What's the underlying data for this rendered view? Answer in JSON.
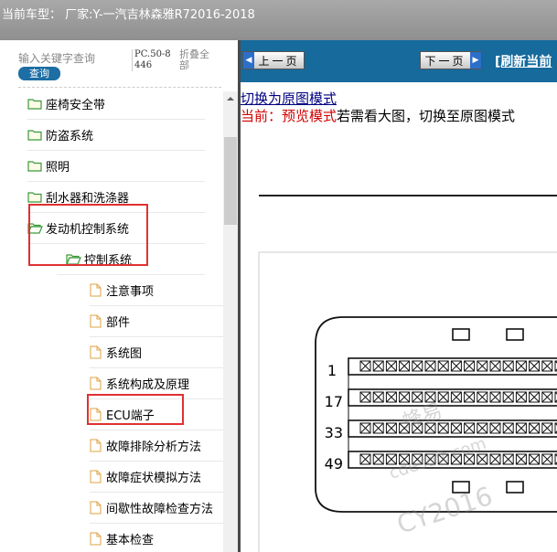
{
  "header": {
    "title": "当前车型：  厂家:Y-一汽吉林森雅R72016-2018"
  },
  "search": {
    "placeholder": "输入关键字查询",
    "button_label": "查询",
    "page_code": "PC.50-8446",
    "collapse_label": "折叠全部"
  },
  "tree": {
    "items": [
      {
        "label": "座椅安全带",
        "type": "folder",
        "level": 0,
        "open": false
      },
      {
        "label": "防盗系统",
        "type": "folder",
        "level": 0,
        "open": false
      },
      {
        "label": "照明",
        "type": "folder",
        "level": 0,
        "open": false
      },
      {
        "label": "刮水器和洗涤器",
        "type": "folder",
        "level": 0,
        "open": false
      },
      {
        "label": "发动机控制系统",
        "type": "folder",
        "level": 0,
        "open": true
      },
      {
        "label": "控制系统",
        "type": "folder",
        "level": 1,
        "open": true
      },
      {
        "label": "注意事项",
        "type": "doc",
        "level": 2
      },
      {
        "label": "部件",
        "type": "doc",
        "level": 2
      },
      {
        "label": "系统图",
        "type": "doc",
        "level": 2
      },
      {
        "label": "系统构成及原理",
        "type": "doc",
        "level": 2
      },
      {
        "label": "ECU端子",
        "type": "doc",
        "level": 2
      },
      {
        "label": "故障排除分析方法",
        "type": "doc",
        "level": 2
      },
      {
        "label": "故障症状模拟方法",
        "type": "doc",
        "level": 2
      },
      {
        "label": "间歇性故障检查方法",
        "type": "doc",
        "level": 2
      },
      {
        "label": "基本检查",
        "type": "doc",
        "level": 2
      }
    ]
  },
  "viewer": {
    "prev_label": "上一页",
    "next_label": "下一页",
    "refresh_label": "[刷新当前",
    "switch_link": "切换为原图模式",
    "status_label": "当前：预览模式",
    "status_hint": "若需看大图，切换至原图模式"
  },
  "diagram": {
    "row_labels": [
      "1",
      "17",
      "33",
      "49"
    ],
    "watermark": [
      "蜂易",
      "cdesoft.com",
      "CY2016"
    ]
  },
  "colors": {
    "nav_bar": "#176a9c",
    "highlight": "#e03131",
    "status_red": "#d00000",
    "link": "#000080"
  }
}
